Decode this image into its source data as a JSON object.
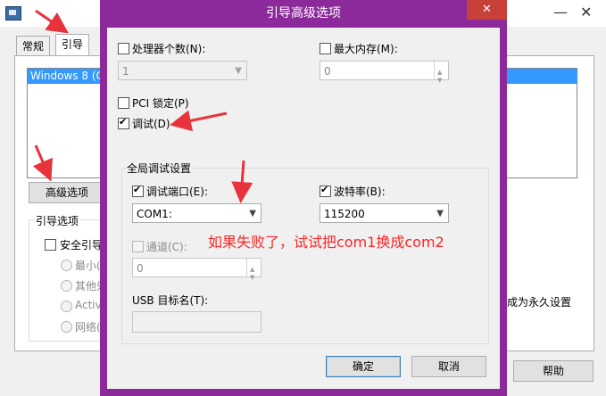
{
  "background_window": {
    "tabs": [
      "常规",
      "引导"
    ],
    "os_entry": "Windows 8 (C",
    "advanced_button": "高级选项",
    "group_title": "引导选项",
    "safe_boot_label": "安全引导",
    "radio_labels": [
      "最小(",
      "其他外",
      "Activ",
      "网络("
    ],
    "make_permanent_text": "成为永久设置",
    "help_button": "帮助"
  },
  "dialog": {
    "title": "引导高级选项",
    "close_glyph": "✕",
    "processors": {
      "label": "处理器个数(N):",
      "value": "1"
    },
    "max_memory": {
      "label": "最大内存(M):",
      "value": "0"
    },
    "pci_lock": "PCI 锁定(P)",
    "debug": "调试(D)",
    "global_debug_group": "全局调试设置",
    "debug_port": {
      "label": "调试端口(E):",
      "value": "COM1:"
    },
    "baud_rate": {
      "label": "波特率(B):",
      "value": "115200"
    },
    "channel": {
      "label": "通道(C):",
      "value": "0"
    },
    "usb_target": {
      "label": "USB 目标名(T):",
      "value": ""
    },
    "ok_button": "确定",
    "cancel_button": "取消"
  },
  "annotation": {
    "text": "如果失败了，试试把com1换成com2",
    "color": "#ff2424"
  },
  "colors": {
    "dialog_frame": "#8c2a9c",
    "close_button": "#c7403a",
    "selection": "#3399ff",
    "arrow": "#e8323c"
  }
}
